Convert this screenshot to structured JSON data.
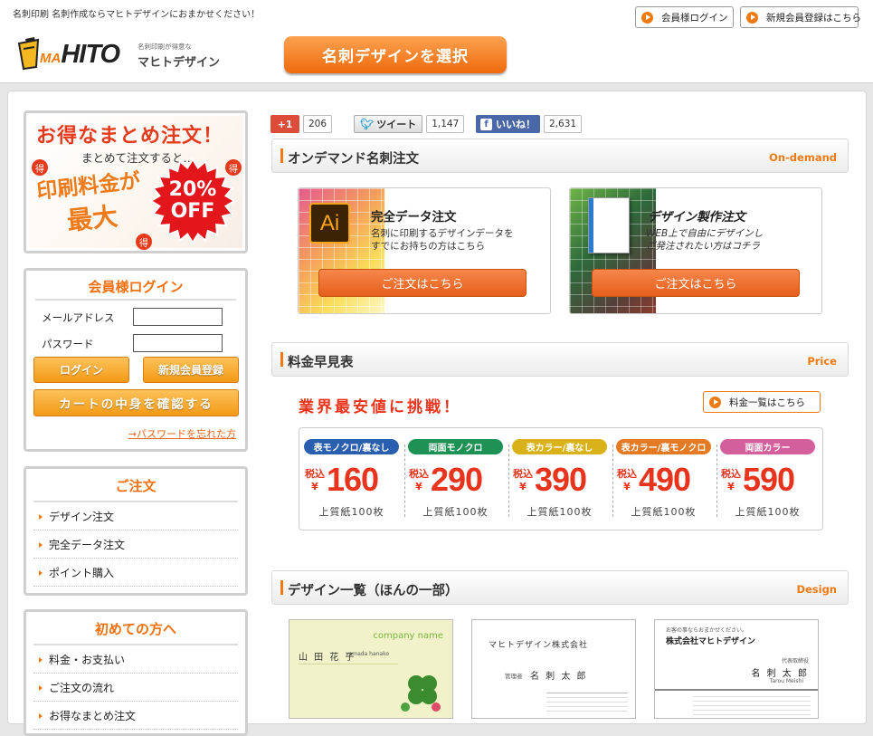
{
  "header": {
    "tagline": "名刺印刷 名刺作成ならマヒトデザインにおまかせください！",
    "member_login": "会員様ログイン",
    "register": "新規会員登録はこちら",
    "logo_word_ma": "MA",
    "logo_word_rest": "HITO",
    "logo_sub": "名刺印刷が得意な",
    "logo_name": "マヒトデザイン",
    "select_design": "名刺デザインを選択"
  },
  "banner": {
    "line1": "お得なまとめ注文！",
    "line2": "まとめて注文すると…",
    "line3": "印刷料金が",
    "line4": "最大",
    "badge_pct": "20%",
    "badge_off": "OFF",
    "toku": "得"
  },
  "login": {
    "title": "会員様ログイン",
    "email_label": "メールアドレス",
    "password_label": "パスワード",
    "email_value": "",
    "password_value": "",
    "login_btn": "ログイン",
    "register_btn": "新規会員登録",
    "cart_btn": "カートの中身を確認する",
    "forgot": "→パスワードを忘れた方"
  },
  "order_menu": {
    "title": "ご注文",
    "items": [
      "デザイン注文",
      "完全データ注文",
      "ポイント購入"
    ]
  },
  "beginner_menu": {
    "title": "初めての方へ",
    "items": [
      "料金・お支払い",
      "ご注文の流れ",
      "お得なまとめ注文"
    ]
  },
  "social": {
    "gplus_label": "+1",
    "gplus_count": "206",
    "tweet_label": "ツイート",
    "tweet_count": "1,147",
    "like_label": "いいね！",
    "like_count": "2,631"
  },
  "ondemand": {
    "title": "オンデマンド名刺注文",
    "en": "On-demand",
    "card1": {
      "ai": "Ai",
      "title": "完全データ注文",
      "desc1": "名刺に印刷するデザインデータを",
      "desc2": "すでにお持ちの方はこちら",
      "btn": "ご注文はこちら"
    },
    "card2": {
      "title": "デザイン製作注文",
      "desc1": "WEB上で自由にデザインし",
      "desc2": "ご発注されたい方はコチラ",
      "btn": "ご注文はこちら"
    }
  },
  "price": {
    "title": "料金早見表",
    "en": "Price",
    "challenge": "業界最安値に挑戦！",
    "list_btn": "料金一覧はこちら",
    "tax": "税込",
    "yen": "¥",
    "paper": "上質紙100枚",
    "plans": [
      {
        "label": "表モノクロ/裏なし",
        "price": "160",
        "color": "#2a5fb0"
      },
      {
        "label": "両面モノクロ",
        "price": "290",
        "color": "#1e9255"
      },
      {
        "label": "表カラー/裏なし",
        "price": "390",
        "color": "#d9b21a"
      },
      {
        "label": "表カラー/裏モノクロ",
        "price": "490",
        "color": "#e57a25"
      },
      {
        "label": "両面カラー",
        "price": "590",
        "color": "#d45f9d"
      }
    ]
  },
  "design": {
    "title": "デザイン一覧（ほんの一部）",
    "en": "Design",
    "card1": {
      "company": "company name",
      "name": "山 田 花 子",
      "romaji": "yamada hanako"
    },
    "card2": {
      "company": "マヒトデザイン株式会社",
      "role": "管理者",
      "name": "名 刺 太 郎"
    },
    "card3": {
      "tag": "お客の事ならおまかせください。",
      "company": "株式会社マヒトデザイン",
      "role": "代表取締役",
      "name": "名 刺 太 郎",
      "romaji": "Tarou Meishi"
    }
  },
  "colors": {
    "accent": "#f07a12",
    "price_red": "#e8341c"
  }
}
